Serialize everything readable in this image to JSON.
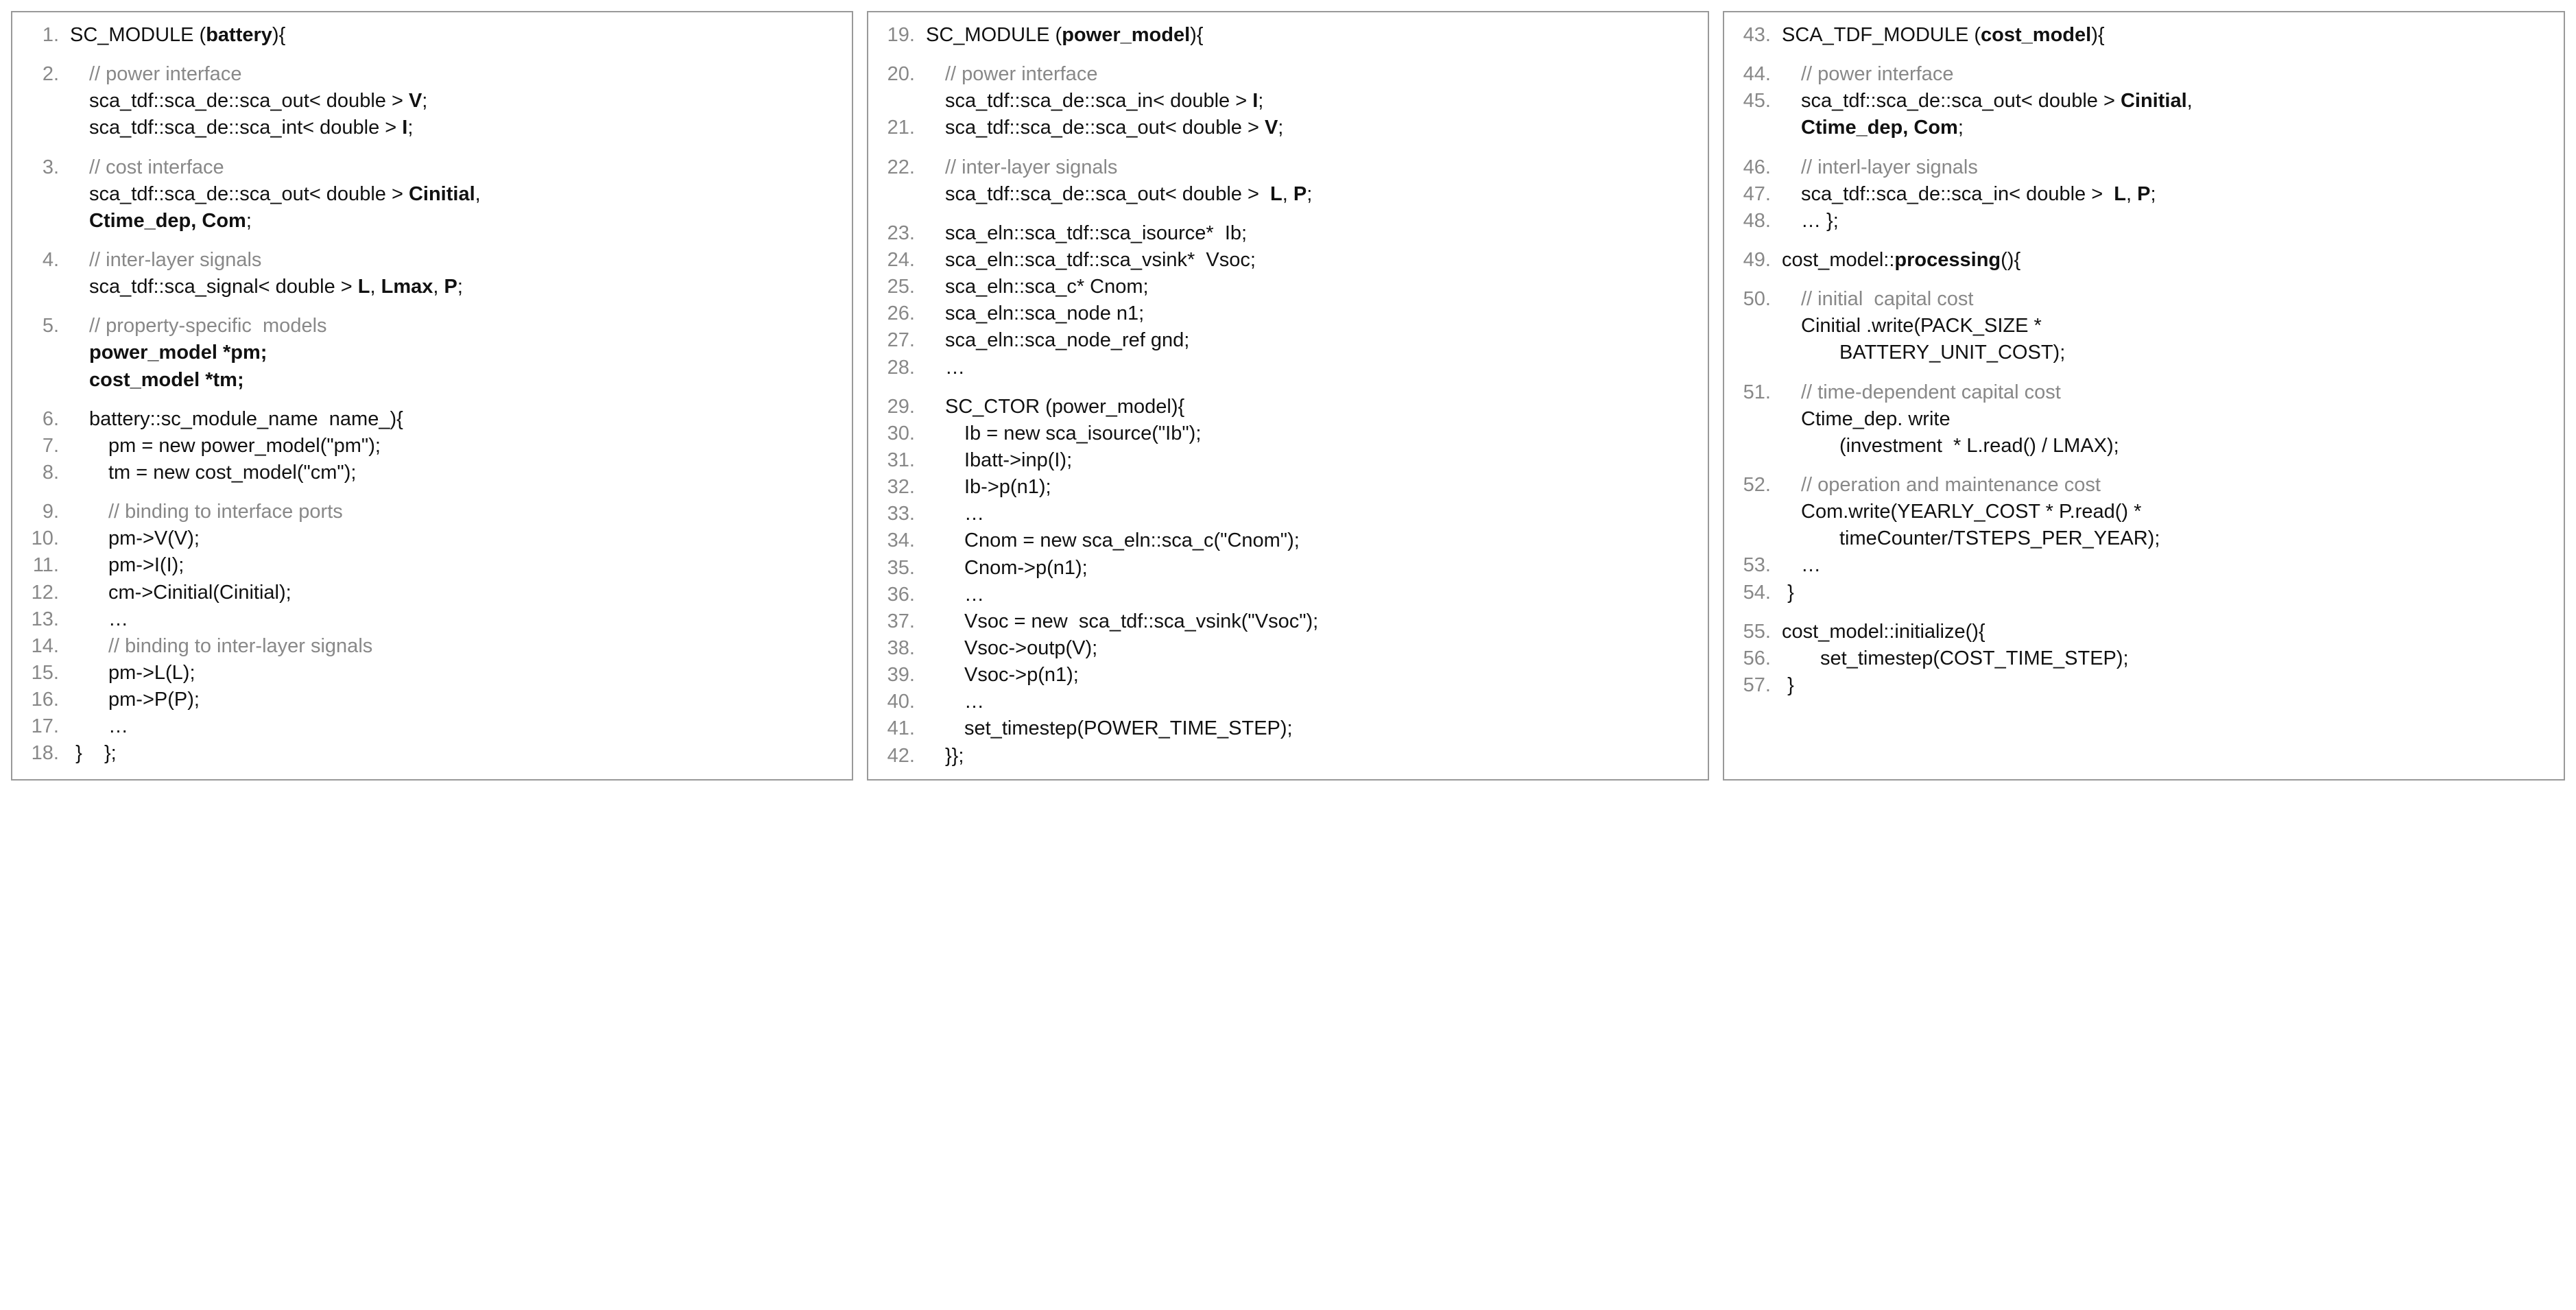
{
  "panels": [
    {
      "id": "battery",
      "lines": [
        {
          "num": "1.",
          "segs": [
            {
              "t": "SC_MODULE ("
            },
            {
              "t": "battery",
              "b": 1
            },
            {
              "t": "){"
            }
          ]
        },
        {
          "blank": 1
        },
        {
          "num": "2.",
          "indent": 1,
          "segs": [
            {
              "t": "// power interface",
              "c": 1
            }
          ]
        },
        {
          "indent": 1,
          "segs": [
            {
              "t": "sca_tdf::sca_de::sca_out< double > "
            },
            {
              "t": "V",
              "b": 1
            },
            {
              "t": ";"
            }
          ]
        },
        {
          "indent": 1,
          "segs": [
            {
              "t": "sca_tdf::sca_de::sca_int< double > "
            },
            {
              "t": "I",
              "b": 1
            },
            {
              "t": ";"
            }
          ]
        },
        {
          "blank": 1
        },
        {
          "num": "3.",
          "indent": 1,
          "segs": [
            {
              "t": "// cost interface",
              "c": 1
            }
          ]
        },
        {
          "indent": 1,
          "segs": [
            {
              "t": "sca_tdf::sca_de::sca_out< double > "
            },
            {
              "t": "Cinitial",
              "b": 1
            },
            {
              "t": ","
            }
          ]
        },
        {
          "indent": 1,
          "segs": [
            {
              "t": "Ctime_dep, Com",
              "b": 1
            },
            {
              "t": ";"
            }
          ]
        },
        {
          "blank": 1
        },
        {
          "num": "4.",
          "indent": 1,
          "segs": [
            {
              "t": "// inter-layer signals",
              "c": 1
            }
          ]
        },
        {
          "indent": 1,
          "segs": [
            {
              "t": "sca_tdf::sca_signal< double > "
            },
            {
              "t": "L",
              "b": 1
            },
            {
              "t": ", "
            },
            {
              "t": "Lmax",
              "b": 1
            },
            {
              "t": ", "
            },
            {
              "t": "P",
              "b": 1
            },
            {
              "t": ";"
            }
          ]
        },
        {
          "blank": 1
        },
        {
          "num": "5.",
          "indent": 1,
          "segs": [
            {
              "t": "// property-specific  models",
              "c": 1
            }
          ]
        },
        {
          "indent": 1,
          "segs": [
            {
              "t": "power_model *pm;",
              "b": 1
            }
          ]
        },
        {
          "indent": 1,
          "segs": [
            {
              "t": "cost_model *tm;",
              "b": 1
            }
          ]
        },
        {
          "blank": 1
        },
        {
          "num": "6.",
          "indent": 1,
          "segs": [
            {
              "t": "battery::sc_module_name  name_){"
            }
          ]
        },
        {
          "num": "7.",
          "indent": 2,
          "segs": [
            {
              "t": "pm = new power_model(\"pm\");"
            }
          ]
        },
        {
          "num": "8.",
          "indent": 2,
          "segs": [
            {
              "t": "tm = new cost_model(\"cm\");"
            }
          ]
        },
        {
          "blank": 1
        },
        {
          "num": "9.",
          "indent": 2,
          "segs": [
            {
              "t": "// binding to interface ports",
              "c": 1
            }
          ]
        },
        {
          "num": "10.",
          "indent": 2,
          "segs": [
            {
              "t": "pm->V(V);"
            }
          ]
        },
        {
          "num": "11.",
          "indent": 2,
          "segs": [
            {
              "t": "pm->I(I);"
            }
          ]
        },
        {
          "num": "12.",
          "indent": 2,
          "segs": [
            {
              "t": "cm->Cinitial(Cinitial);"
            }
          ]
        },
        {
          "num": "13.",
          "indent": 2,
          "segs": [
            {
              "t": "…"
            }
          ]
        },
        {
          "num": "14.",
          "indent": 2,
          "segs": [
            {
              "t": "// binding to inter-layer signals",
              "c": 1
            }
          ]
        },
        {
          "num": "15.",
          "indent": 2,
          "segs": [
            {
              "t": "pm->L(L);"
            }
          ]
        },
        {
          "num": "16.",
          "indent": 2,
          "segs": [
            {
              "t": "pm->P(P);"
            }
          ]
        },
        {
          "num": "17.",
          "indent": 2,
          "segs": [
            {
              "t": "…"
            }
          ]
        },
        {
          "num": "18.",
          "segs": [
            {
              "t": " }    };"
            }
          ]
        }
      ]
    },
    {
      "id": "power_model",
      "lines": [
        {
          "num": "19.",
          "segs": [
            {
              "t": "SC_MODULE ("
            },
            {
              "t": "power_model",
              "b": 1
            },
            {
              "t": "){"
            }
          ]
        },
        {
          "blank": 1
        },
        {
          "num": "20.",
          "indent": 1,
          "segs": [
            {
              "t": "// power interface",
              "c": 1
            }
          ]
        },
        {
          "indent": 1,
          "segs": [
            {
              "t": "sca_tdf::sca_de::sca_in< double > "
            },
            {
              "t": "I",
              "b": 1
            },
            {
              "t": ";"
            }
          ]
        },
        {
          "num": "21.",
          "indent": 1,
          "segs": [
            {
              "t": "sca_tdf::sca_de::sca_out< double > "
            },
            {
              "t": "V",
              "b": 1
            },
            {
              "t": ";"
            }
          ]
        },
        {
          "blank": 1
        },
        {
          "num": "22.",
          "indent": 1,
          "segs": [
            {
              "t": "// inter-layer signals",
              "c": 1
            }
          ]
        },
        {
          "indent": 1,
          "segs": [
            {
              "t": "sca_tdf::sca_de::sca_out< double >  "
            },
            {
              "t": "L",
              "b": 1
            },
            {
              "t": ", "
            },
            {
              "t": "P",
              "b": 1
            },
            {
              "t": ";"
            }
          ]
        },
        {
          "blank": 1
        },
        {
          "num": "23.",
          "indent": 1,
          "segs": [
            {
              "t": "sca_eln::sca_tdf::sca_isource*  Ib;"
            }
          ]
        },
        {
          "num": "24.",
          "indent": 1,
          "segs": [
            {
              "t": "sca_eln::sca_tdf::sca_vsink*  Vsoc;"
            }
          ]
        },
        {
          "num": "25.",
          "indent": 1,
          "segs": [
            {
              "t": "sca_eln::sca_c* Cnom;"
            }
          ]
        },
        {
          "num": "26.",
          "indent": 1,
          "segs": [
            {
              "t": "sca_eln::sca_node n1;"
            }
          ]
        },
        {
          "num": "27.",
          "indent": 1,
          "segs": [
            {
              "t": "sca_eln::sca_node_ref gnd;"
            }
          ]
        },
        {
          "num": "28.",
          "indent": 1,
          "segs": [
            {
              "t": "…"
            }
          ]
        },
        {
          "blank": 1
        },
        {
          "num": "29.",
          "indent": 1,
          "segs": [
            {
              "t": "SC_CTOR (power_model){"
            }
          ]
        },
        {
          "num": "30.",
          "indent": 2,
          "segs": [
            {
              "t": "Ib = new sca_isource(\"Ib\");"
            }
          ]
        },
        {
          "num": "31.",
          "indent": 2,
          "segs": [
            {
              "t": "Ibatt->inp(I);"
            }
          ]
        },
        {
          "num": "32.",
          "indent": 2,
          "segs": [
            {
              "t": "Ib->p(n1);"
            }
          ]
        },
        {
          "num": "33.",
          "indent": 2,
          "segs": [
            {
              "t": "…"
            }
          ]
        },
        {
          "num": "34.",
          "indent": 2,
          "segs": [
            {
              "t": "Cnom = new sca_eln::sca_c(\"Cnom\");"
            }
          ]
        },
        {
          "num": "35.",
          "indent": 2,
          "segs": [
            {
              "t": "Cnom->p(n1);"
            }
          ]
        },
        {
          "num": "36.",
          "indent": 2,
          "segs": [
            {
              "t": "…"
            }
          ]
        },
        {
          "num": "37.",
          "indent": 2,
          "segs": [
            {
              "t": "Vsoc = new  sca_tdf::sca_vsink(\"Vsoc\");"
            }
          ]
        },
        {
          "num": "38.",
          "indent": 2,
          "segs": [
            {
              "t": "Vsoc->outp(V);"
            }
          ]
        },
        {
          "num": "39.",
          "indent": 2,
          "segs": [
            {
              "t": "Vsoc->p(n1);"
            }
          ]
        },
        {
          "num": "40.",
          "indent": 2,
          "segs": [
            {
              "t": "…"
            }
          ]
        },
        {
          "num": "41.",
          "indent": 2,
          "segs": [
            {
              "t": "set_timestep(POWER_TIME_STEP);"
            }
          ]
        },
        {
          "num": "42.",
          "indent": 1,
          "segs": [
            {
              "t": "}};"
            }
          ]
        }
      ]
    },
    {
      "id": "cost_model",
      "lines": [
        {
          "num": "43.",
          "segs": [
            {
              "t": "SCA_TDF_MODULE ("
            },
            {
              "t": "cost_model",
              "b": 1
            },
            {
              "t": "){"
            }
          ]
        },
        {
          "blank": 1
        },
        {
          "num": "44.",
          "indent": 1,
          "segs": [
            {
              "t": "// power interface",
              "c": 1
            }
          ]
        },
        {
          "num": "45.",
          "indent": 1,
          "segs": [
            {
              "t": "sca_tdf::sca_de::sca_out< double > "
            },
            {
              "t": "Cinitial",
              "b": 1
            },
            {
              "t": ","
            }
          ]
        },
        {
          "indent": 1,
          "segs": [
            {
              "t": "Ctime_dep, Com",
              "b": 1
            },
            {
              "t": ";"
            }
          ]
        },
        {
          "blank": 1
        },
        {
          "num": "46.",
          "indent": 1,
          "segs": [
            {
              "t": "// interl-layer signals",
              "c": 1
            }
          ]
        },
        {
          "num": "47.",
          "indent": 1,
          "segs": [
            {
              "t": "sca_tdf::sca_de::sca_in< double >  "
            },
            {
              "t": "L",
              "b": 1
            },
            {
              "t": ", "
            },
            {
              "t": "P",
              "b": 1
            },
            {
              "t": ";"
            }
          ]
        },
        {
          "num": "48.",
          "indent": 1,
          "segs": [
            {
              "t": "… };"
            }
          ]
        },
        {
          "blank": 1
        },
        {
          "num": "49.",
          "segs": [
            {
              "t": "cost_model::"
            },
            {
              "t": "processing",
              "b": 1
            },
            {
              "t": "(){"
            }
          ]
        },
        {
          "blank": 1
        },
        {
          "num": "50.",
          "indent": 1,
          "segs": [
            {
              "t": "// initial  capital cost",
              "c": 1
            }
          ]
        },
        {
          "indent": 1,
          "segs": [
            {
              "t": "Cinitial .write(PACK_SIZE *"
            }
          ]
        },
        {
          "indent": 3,
          "segs": [
            {
              "t": "BATTERY_UNIT_COST);"
            }
          ]
        },
        {
          "blank": 1
        },
        {
          "num": "51.",
          "indent": 1,
          "segs": [
            {
              "t": "// time-dependent capital cost",
              "c": 1
            }
          ]
        },
        {
          "indent": 1,
          "segs": [
            {
              "t": "Ctime_dep. write"
            }
          ]
        },
        {
          "indent": 3,
          "segs": [
            {
              "t": "(investment  * L.read() / LMAX);"
            }
          ]
        },
        {
          "blank": 1
        },
        {
          "num": "52.",
          "indent": 1,
          "segs": [
            {
              "t": "// operation and maintenance cost",
              "c": 1
            }
          ]
        },
        {
          "indent": 1,
          "segs": [
            {
              "t": "Com.write(YEARLY_COST * P.read() *"
            }
          ]
        },
        {
          "indent": 3,
          "segs": [
            {
              "t": "timeCounter/TSTEPS_PER_YEAR);"
            }
          ]
        },
        {
          "num": "53.",
          "indent": 1,
          "segs": [
            {
              "t": "…"
            }
          ]
        },
        {
          "num": "54.",
          "segs": [
            {
              "t": " }"
            }
          ]
        },
        {
          "blank": 1
        },
        {
          "num": "55.",
          "segs": [
            {
              "t": "cost_model::initialize(){"
            }
          ]
        },
        {
          "num": "56.",
          "indent": 2,
          "segs": [
            {
              "t": "set_timestep(COST_TIME_STEP);"
            }
          ]
        },
        {
          "num": "57.",
          "segs": [
            {
              "t": " }"
            }
          ]
        }
      ]
    }
  ]
}
